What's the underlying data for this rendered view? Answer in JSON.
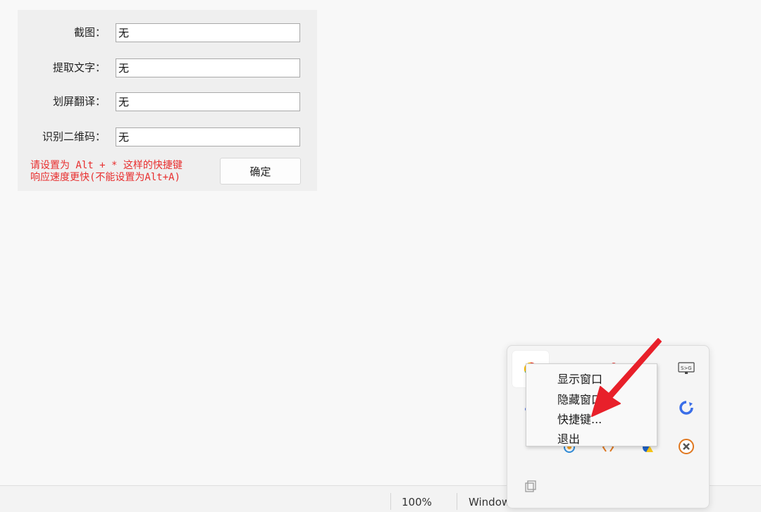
{
  "dialog": {
    "rows": [
      {
        "label": "截图：",
        "value": "无"
      },
      {
        "label": "提取文字：",
        "value": "无"
      },
      {
        "label": "划屏翻译：",
        "value": "无"
      },
      {
        "label": "识别二维码：",
        "value": "无"
      }
    ],
    "hint_line1": "请设置为 Alt + * 这样的快捷键",
    "hint_line2": "响应速度更快(不能设置为Alt+A)",
    "ok_label": "确定",
    "hint_color": "#e82e2e"
  },
  "context_menu": {
    "items": [
      "显示窗口",
      "隐藏窗口",
      "快捷键...",
      "退出"
    ]
  },
  "taskbar": {
    "zoom": "100%",
    "status_text": "Window"
  },
  "tray": {
    "icons": [
      "google-color-icon",
      "red-badge-icon",
      "blue-red-app-icon",
      "black-app-icon",
      "screen-translate-icon",
      "blue-dot-icon",
      "blue-refresh-icon",
      "globe-app-icon",
      "orange-code-icon",
      "shield-warning-icon",
      "orange-close-icon",
      "copy-icon"
    ]
  },
  "annotation": {
    "arrow_color": "#e8202a"
  }
}
